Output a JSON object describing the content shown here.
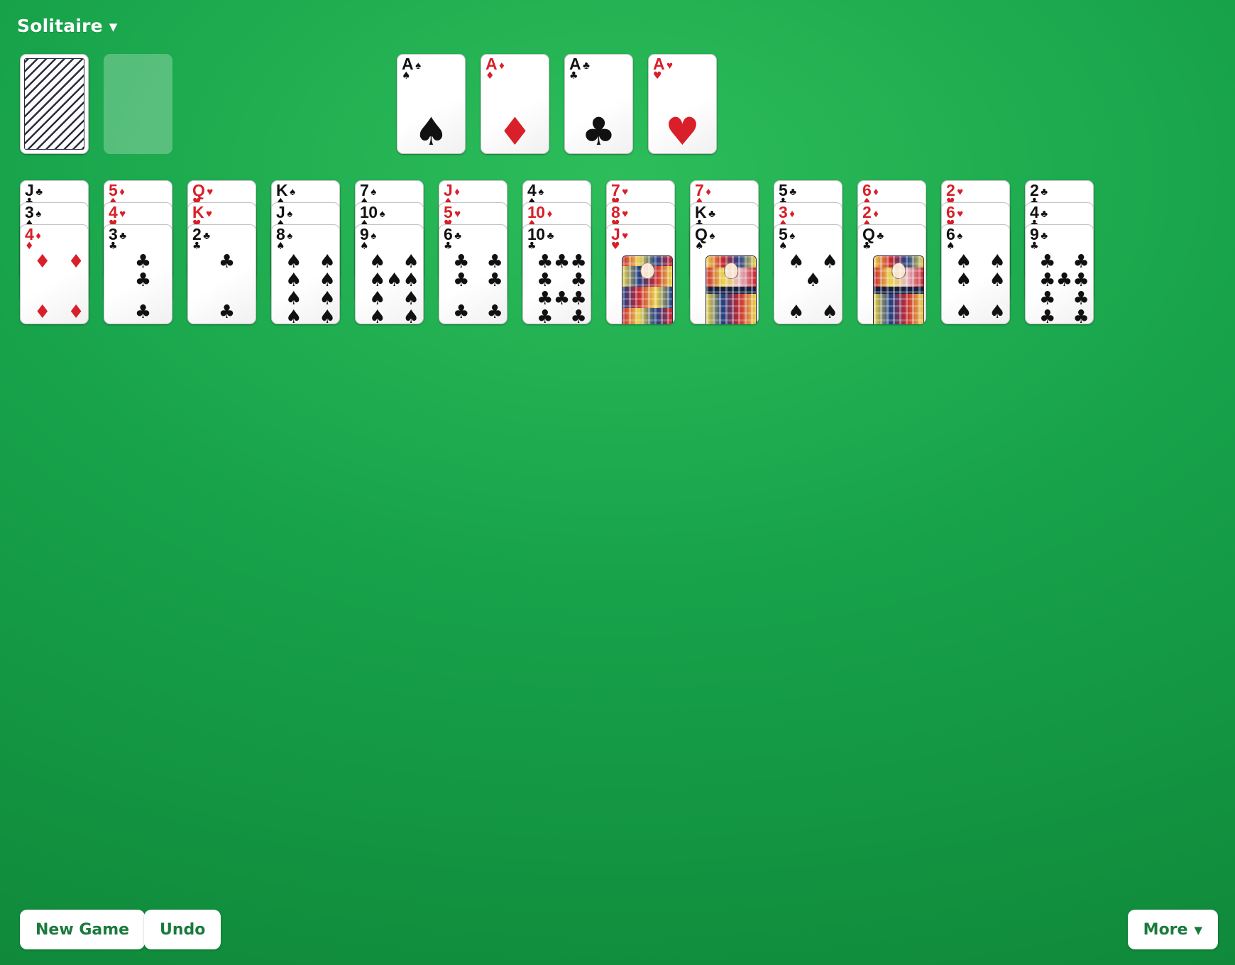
{
  "header": {
    "title": "Solitaire",
    "caret": "▼"
  },
  "icons": {
    "caret_down": "▼"
  },
  "colors": {
    "table_green": "#17a24a",
    "red_suit": "#d81f2a",
    "black_suit": "#111111",
    "button_text": "#1a7a3c",
    "card_white": "#ffffff"
  },
  "suits": {
    "spade": "♠",
    "heart": "♥",
    "diamond": "♦",
    "club": "♣"
  },
  "stock": {
    "label": "stock-pile",
    "face_down": true,
    "count_visible": 1
  },
  "waste": {
    "label": "waste-pile",
    "empty": true
  },
  "foundations": [
    {
      "rank": "A",
      "suit": "spade",
      "symbol": "♠",
      "color": "black",
      "pips": 1
    },
    {
      "rank": "A",
      "suit": "diamond",
      "symbol": "♦",
      "color": "red",
      "pips": 1
    },
    {
      "rank": "A",
      "suit": "club",
      "symbol": "♣",
      "color": "black",
      "pips": 1
    },
    {
      "rank": "A",
      "suit": "heart",
      "symbol": "♥",
      "color": "red",
      "pips": 1
    }
  ],
  "tableau": [
    {
      "column": 1,
      "cards": [
        {
          "rank": "J",
          "suit": "club",
          "symbol": "♣",
          "color": "black",
          "face_up": true,
          "type": "face"
        },
        {
          "rank": "3",
          "suit": "spade",
          "symbol": "♠",
          "color": "black",
          "face_up": true,
          "type": "pip"
        },
        {
          "rank": "4",
          "suit": "diamond",
          "symbol": "♦",
          "color": "red",
          "face_up": true,
          "type": "pip"
        }
      ]
    },
    {
      "column": 2,
      "cards": [
        {
          "rank": "5",
          "suit": "diamond",
          "symbol": "♦",
          "color": "red",
          "face_up": true,
          "type": "pip"
        },
        {
          "rank": "4",
          "suit": "heart",
          "symbol": "♥",
          "color": "red",
          "face_up": true,
          "type": "pip"
        },
        {
          "rank": "3",
          "suit": "club",
          "symbol": "♣",
          "color": "black",
          "face_up": true,
          "type": "pip"
        }
      ]
    },
    {
      "column": 3,
      "cards": [
        {
          "rank": "Q",
          "suit": "heart",
          "symbol": "♥",
          "color": "red",
          "face_up": true,
          "type": "face"
        },
        {
          "rank": "K",
          "suit": "heart",
          "symbol": "♥",
          "color": "red",
          "face_up": true,
          "type": "face"
        },
        {
          "rank": "2",
          "suit": "club",
          "symbol": "♣",
          "color": "black",
          "face_up": true,
          "type": "pip"
        }
      ]
    },
    {
      "column": 4,
      "cards": [
        {
          "rank": "K",
          "suit": "spade",
          "symbol": "♠",
          "color": "black",
          "face_up": true,
          "type": "face"
        },
        {
          "rank": "J",
          "suit": "spade",
          "symbol": "♠",
          "color": "black",
          "face_up": true,
          "type": "face"
        },
        {
          "rank": "8",
          "suit": "spade",
          "symbol": "♠",
          "color": "black",
          "face_up": true,
          "type": "pip"
        }
      ]
    },
    {
      "column": 5,
      "cards": [
        {
          "rank": "7",
          "suit": "spade",
          "symbol": "♠",
          "color": "black",
          "face_up": true,
          "type": "pip"
        },
        {
          "rank": "10",
          "suit": "spade",
          "symbol": "♠",
          "color": "black",
          "face_up": true,
          "type": "pip"
        },
        {
          "rank": "9",
          "suit": "spade",
          "symbol": "♠",
          "color": "black",
          "face_up": true,
          "type": "pip"
        }
      ]
    },
    {
      "column": 6,
      "cards": [
        {
          "rank": "J",
          "suit": "diamond",
          "symbol": "♦",
          "color": "red",
          "face_up": true,
          "type": "face"
        },
        {
          "rank": "5",
          "suit": "heart",
          "symbol": "♥",
          "color": "red",
          "face_up": true,
          "type": "pip"
        },
        {
          "rank": "6",
          "suit": "club",
          "symbol": "♣",
          "color": "black",
          "face_up": true,
          "type": "pip"
        }
      ]
    },
    {
      "column": 7,
      "cards": [
        {
          "rank": "4",
          "suit": "spade",
          "symbol": "♠",
          "color": "black",
          "face_up": true,
          "type": "pip"
        },
        {
          "rank": "10",
          "suit": "diamond",
          "symbol": "♦",
          "color": "red",
          "face_up": true,
          "type": "pip"
        },
        {
          "rank": "10",
          "suit": "club",
          "symbol": "♣",
          "color": "black",
          "face_up": true,
          "type": "pip"
        }
      ]
    },
    {
      "column": 8,
      "cards": [
        {
          "rank": "7",
          "suit": "heart",
          "symbol": "♥",
          "color": "red",
          "face_up": true,
          "type": "pip"
        },
        {
          "rank": "8",
          "suit": "heart",
          "symbol": "♥",
          "color": "red",
          "face_up": true,
          "type": "pip"
        },
        {
          "rank": "J",
          "suit": "heart",
          "symbol": "♥",
          "color": "red",
          "face_up": true,
          "type": "face"
        }
      ]
    },
    {
      "column": 9,
      "cards": [
        {
          "rank": "7",
          "suit": "diamond",
          "symbol": "♦",
          "color": "red",
          "face_up": true,
          "type": "pip"
        },
        {
          "rank": "K",
          "suit": "club",
          "symbol": "♣",
          "color": "black",
          "face_up": true,
          "type": "face"
        },
        {
          "rank": "Q",
          "suit": "spade",
          "symbol": "♠",
          "color": "black",
          "face_up": true,
          "type": "face"
        }
      ]
    },
    {
      "column": 10,
      "cards": [
        {
          "rank": "5",
          "suit": "club",
          "symbol": "♣",
          "color": "black",
          "face_up": true,
          "type": "pip"
        },
        {
          "rank": "3",
          "suit": "diamond",
          "symbol": "♦",
          "color": "red",
          "face_up": true,
          "type": "pip"
        },
        {
          "rank": "5",
          "suit": "spade",
          "symbol": "♠",
          "color": "black",
          "face_up": true,
          "type": "pip"
        }
      ]
    },
    {
      "column": 11,
      "cards": [
        {
          "rank": "6",
          "suit": "diamond",
          "symbol": "♦",
          "color": "red",
          "face_up": true,
          "type": "pip"
        },
        {
          "rank": "2",
          "suit": "diamond",
          "symbol": "♦",
          "color": "red",
          "face_up": true,
          "type": "pip"
        },
        {
          "rank": "Q",
          "suit": "club",
          "symbol": "♣",
          "color": "black",
          "face_up": true,
          "type": "face"
        }
      ]
    },
    {
      "column": 12,
      "cards": [
        {
          "rank": "2",
          "suit": "heart",
          "symbol": "♥",
          "color": "red",
          "face_up": true,
          "type": "pip"
        },
        {
          "rank": "6",
          "suit": "heart",
          "symbol": "♥",
          "color": "red",
          "face_up": true,
          "type": "pip"
        },
        {
          "rank": "6",
          "suit": "spade",
          "symbol": "♠",
          "color": "black",
          "face_up": true,
          "type": "pip"
        }
      ]
    },
    {
      "column": 13,
      "cards": [
        {
          "rank": "2",
          "suit": "club",
          "symbol": "♣",
          "color": "black",
          "face_up": true,
          "type": "pip"
        },
        {
          "rank": "4",
          "suit": "club",
          "symbol": "♣",
          "color": "black",
          "face_up": true,
          "type": "pip"
        },
        {
          "rank": "9",
          "suit": "club",
          "symbol": "♣",
          "color": "black",
          "face_up": true,
          "type": "pip"
        }
      ]
    }
  ],
  "toolbar": {
    "new_game_label": "New Game",
    "undo_label": "Undo",
    "more_label": "More",
    "more_caret": "▼"
  }
}
